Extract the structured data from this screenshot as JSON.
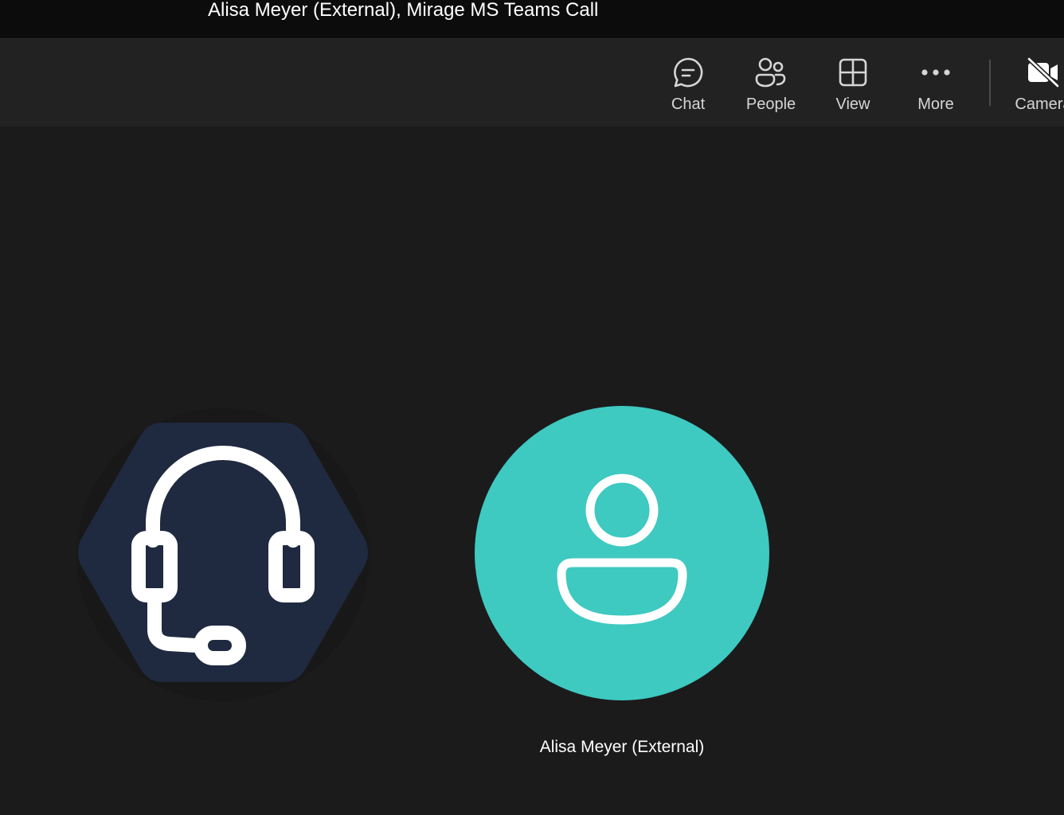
{
  "window": {
    "title": "Alisa Meyer (External), Mirage MS Teams Call"
  },
  "toolbar": {
    "items": [
      {
        "label": "Chat",
        "icon": "chat-icon"
      },
      {
        "label": "People",
        "icon": "people-icon"
      },
      {
        "label": "View",
        "icon": "view-grid-icon"
      },
      {
        "label": "More",
        "icon": "more-icon"
      },
      {
        "label": "Camera",
        "icon": "camera-off-icon"
      }
    ]
  },
  "participants": [
    {
      "type": "bot",
      "icon": "headset-icon",
      "color": "#1f2a40"
    },
    {
      "type": "user",
      "name": "Alisa Meyer (External)",
      "icon": "person-icon",
      "color": "#3ec9c1"
    }
  ]
}
